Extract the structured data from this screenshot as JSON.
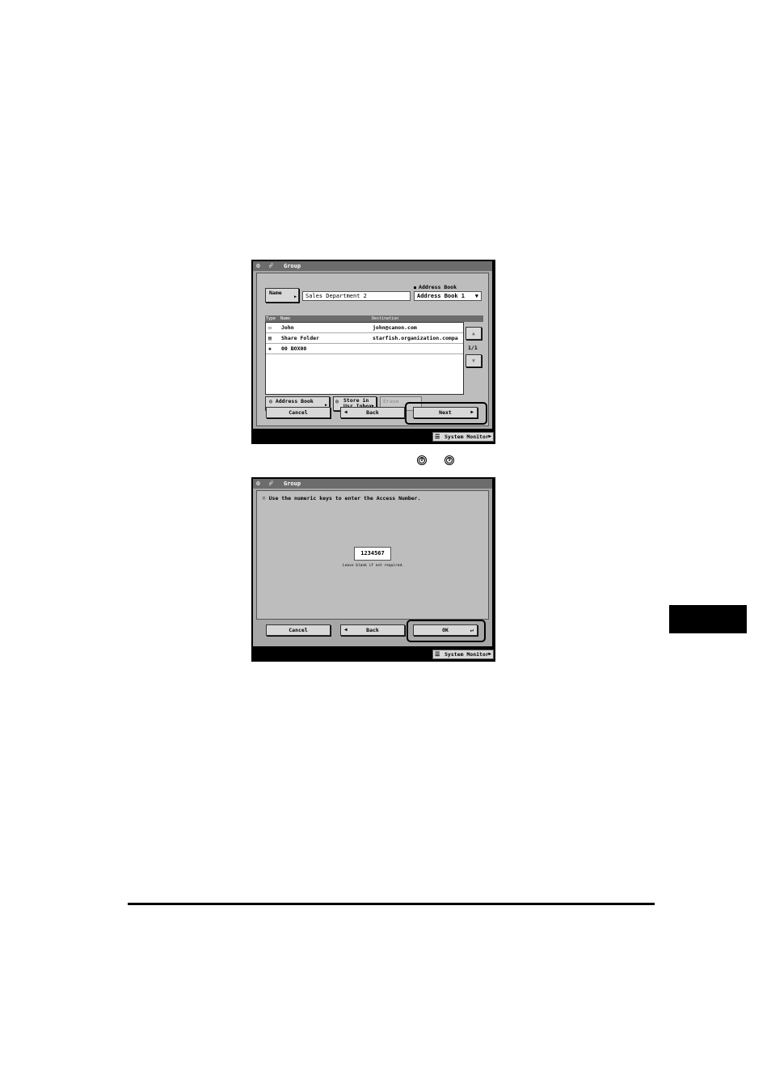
{
  "screen1": {
    "title": "Group",
    "name_button": "Name",
    "name_value": "Sales Department 2",
    "address_book_label": "Address Book",
    "address_book_select": "Address Book 1",
    "columns": {
      "type": "Type",
      "name": "Name",
      "destination": "Destination"
    },
    "rows": [
      {
        "icon": "email-icon",
        "name": "John",
        "destination": "john@canon.com"
      },
      {
        "icon": "file-server-icon",
        "name": "Share Folder",
        "destination": "starfish.organization.compa"
      },
      {
        "icon": "user-inbox-icon",
        "name": "00 BOX00",
        "destination": ""
      }
    ],
    "page_indicator": "1/1",
    "address_book_button": "Address Book",
    "store_inbox_line1": "Store in",
    "store_inbox_line2": "Usr Inbox",
    "erase_button": "Erase",
    "cancel_button": "Cancel",
    "back_button": "Back",
    "next_button": "Next",
    "system_monitor": "System Monitor"
  },
  "keys": {
    "first": "0",
    "last": "9"
  },
  "screen2": {
    "title": "Group",
    "instruction": "Use the numeric keys to enter the Access Number.",
    "access_number": "1234567",
    "hint": "Leave blank if not required.",
    "cancel_button": "Cancel",
    "back_button": "Back",
    "ok_button": "OK",
    "system_monitor": "System Monitor"
  }
}
